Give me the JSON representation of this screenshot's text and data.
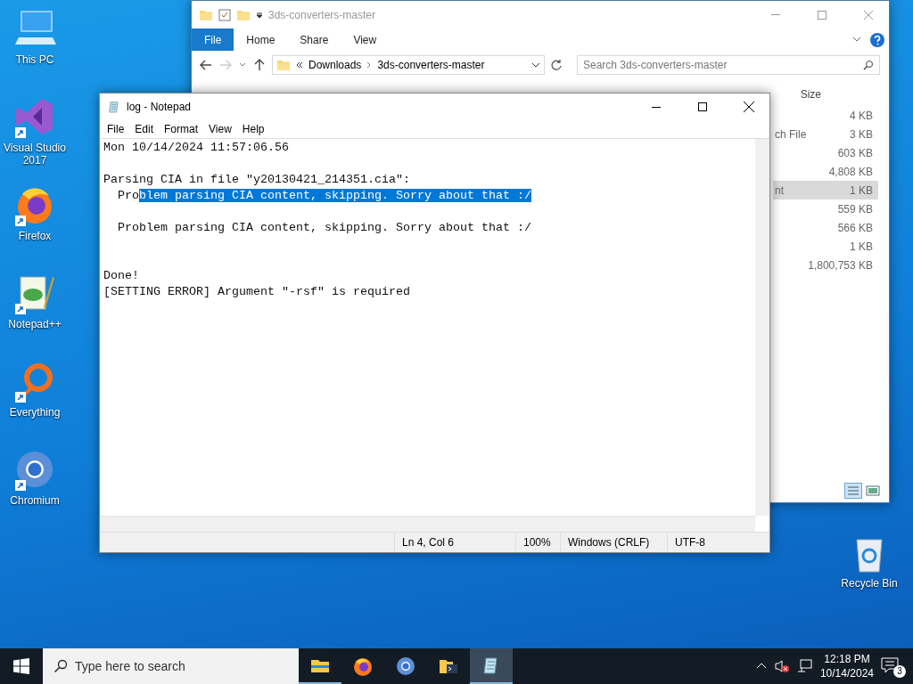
{
  "desktop_icons": [
    {
      "label": "This PC",
      "kind": "pc",
      "shortcut": false
    },
    {
      "label": "Visual Studio 2017",
      "kind": "vs",
      "shortcut": true
    },
    {
      "label": "Firefox",
      "kind": "firefox",
      "shortcut": true
    },
    {
      "label": "Notepad++",
      "kind": "notepadpp",
      "shortcut": true
    },
    {
      "label": "Everything",
      "kind": "everything",
      "shortcut": true
    },
    {
      "label": "Chromium",
      "kind": "chromium",
      "shortcut": true
    }
  ],
  "recycle_bin": {
    "label": "Recycle Bin"
  },
  "explorer": {
    "title": "3ds-converters-master",
    "ribbon_tabs": [
      {
        "label": "File",
        "selected": true
      },
      {
        "label": "Home",
        "selected": false
      },
      {
        "label": "Share",
        "selected": false
      },
      {
        "label": "View",
        "selected": false
      }
    ],
    "breadcrumb": [
      "Downloads",
      "3ds-converters-master"
    ],
    "search": {
      "placeholder": "Search 3ds-converters-master"
    },
    "size_header": "Size",
    "rows": [
      {
        "size": "4 KB",
        "selected": false
      },
      {
        "type": "ch File",
        "size": "3 KB",
        "selected": false
      },
      {
        "size": "603 KB",
        "selected": false
      },
      {
        "size": "4,808 KB",
        "selected": false
      },
      {
        "type": "nt",
        "size": "1 KB",
        "selected": true
      },
      {
        "size": "559 KB",
        "selected": false
      },
      {
        "size": "566 KB",
        "selected": false
      },
      {
        "size": "1 KB",
        "selected": false
      },
      {
        "size": "1,800,753 KB",
        "selected": false
      }
    ]
  },
  "notepad": {
    "title": "log - Notepad",
    "menu": [
      "File",
      "Edit",
      "Format",
      "View",
      "Help"
    ],
    "lines": [
      {
        "kind": "text",
        "text": "Mon 10/14/2024 11:57:06.56"
      },
      {
        "kind": "blank"
      },
      {
        "kind": "text",
        "text": "Parsing CIA in file \"y20130421_214351.cia\":"
      },
      {
        "kind": "text",
        "text": "  Pro",
        "selected_text": "blem parsing CIA content, skipping. Sorry about that :/"
      },
      {
        "kind": "blank"
      },
      {
        "kind": "text",
        "text": "  Problem parsing CIA content, skipping. Sorry about that :/"
      },
      {
        "kind": "blank"
      },
      {
        "kind": "blank"
      },
      {
        "kind": "text",
        "text": "Done!"
      },
      {
        "kind": "text",
        "text": "[SETTING ERROR] Argument \"-rsf\" is required"
      }
    ],
    "status_bar": {
      "position": "Ln 4, Col 6",
      "zoom": "100%",
      "line_endings": "Windows (CRLF)",
      "encoding": "UTF-8"
    }
  },
  "taskbar": {
    "search": {
      "placeholder": "Type here to search"
    },
    "apps": [
      {
        "kind": "explorer",
        "running": true,
        "active": false
      },
      {
        "kind": "firefox",
        "running": false,
        "active": false
      },
      {
        "kind": "chromium",
        "running": false,
        "active": false
      },
      {
        "kind": "folder-terminal",
        "running": false,
        "active": false
      },
      {
        "kind": "notepad",
        "running": true,
        "active": true
      }
    ],
    "time": "12:18 PM",
    "date": "10/14/2024",
    "notification_count": "3"
  }
}
